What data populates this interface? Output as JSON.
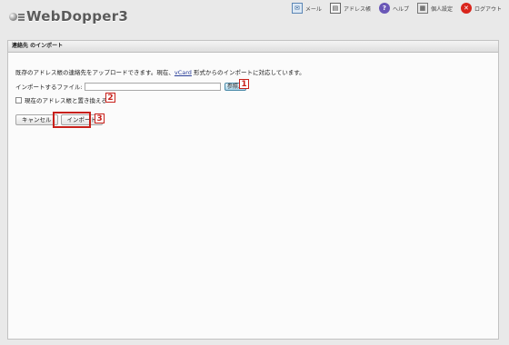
{
  "app": {
    "logo_text": "WebDopper3"
  },
  "topnav": [
    {
      "label": "メール",
      "icon": "mail-icon",
      "glyph": "✉"
    },
    {
      "label": "アドレス帳",
      "icon": "address-book-icon",
      "glyph": "▤"
    },
    {
      "label": "ヘルプ",
      "icon": "help-icon",
      "glyph": "?"
    },
    {
      "label": "個人設定",
      "icon": "settings-icon",
      "glyph": "▦"
    },
    {
      "label": "ログアウト",
      "icon": "logout-icon",
      "glyph": "✕"
    }
  ],
  "panel": {
    "title": "連絡先 のインポート",
    "desc_before": "既存のアドレス帳の連絡先をアップロードできます。現在、",
    "desc_link": "vCard",
    "desc_after": " 形式からのインポートに対応しています。",
    "file_label": "インポートするファイル:",
    "file_value": "",
    "browse_label": "参照...",
    "replace_label": "現在のアドレス帳と置き換える",
    "replace_checked": false,
    "cancel_label": "キャンセル",
    "import_label": "インポート"
  },
  "callouts": [
    "1",
    "2",
    "3"
  ],
  "colors": {
    "callout": "#c8201a",
    "background": "#e9e9e9",
    "panel": "#fbfbfb"
  }
}
